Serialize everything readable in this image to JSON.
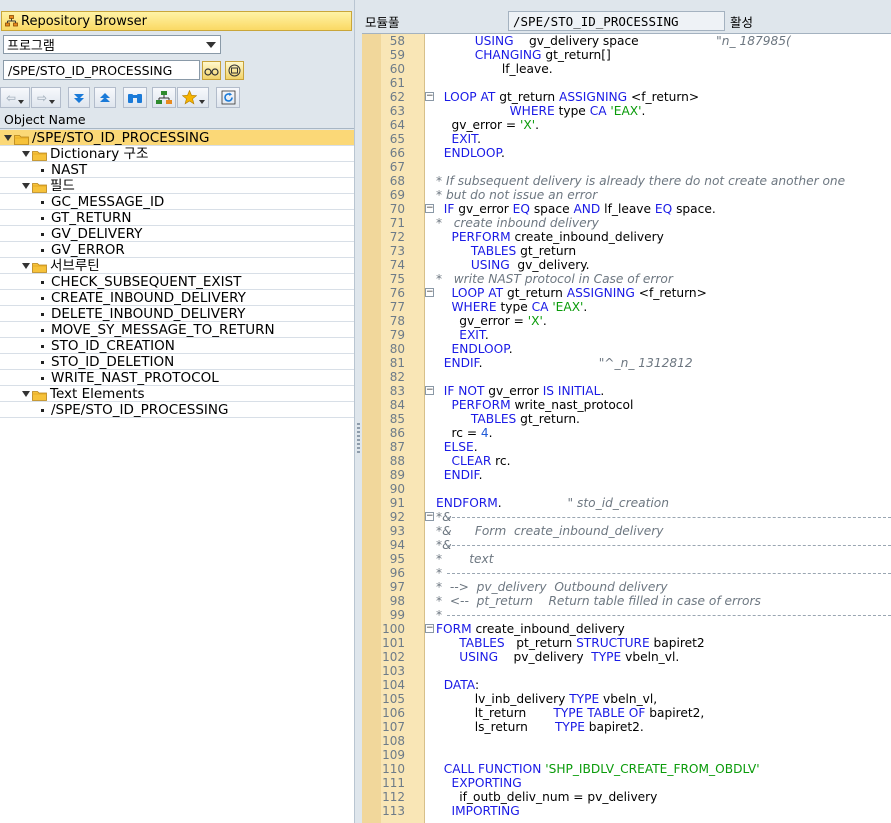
{
  "left": {
    "header_title": "Repository Browser",
    "object_type": "프로그램",
    "object_name_value": "/SPE/STO_ID_PROCESSING",
    "column_header": "Object Name",
    "tree": [
      {
        "label": "/SPE/STO_ID_PROCESSING",
        "level": 0,
        "kind": "folder",
        "selected": true
      },
      {
        "label": "Dictionary 구조",
        "level": 1,
        "kind": "folder"
      },
      {
        "label": "NAST",
        "level": 2,
        "kind": "leaf"
      },
      {
        "label": "필드",
        "level": 1,
        "kind": "folder"
      },
      {
        "label": "GC_MESSAGE_ID",
        "level": 2,
        "kind": "leaf"
      },
      {
        "label": "GT_RETURN",
        "level": 2,
        "kind": "leaf"
      },
      {
        "label": "GV_DELIVERY",
        "level": 2,
        "kind": "leaf"
      },
      {
        "label": "GV_ERROR",
        "level": 2,
        "kind": "leaf"
      },
      {
        "label": "서브루틴",
        "level": 1,
        "kind": "folder"
      },
      {
        "label": "CHECK_SUBSEQUENT_EXIST",
        "level": 2,
        "kind": "leaf"
      },
      {
        "label": "CREATE_INBOUND_DELIVERY",
        "level": 2,
        "kind": "leaf"
      },
      {
        "label": "DELETE_INBOUND_DELIVERY",
        "level": 2,
        "kind": "leaf"
      },
      {
        "label": "MOVE_SY_MESSAGE_TO_RETURN",
        "level": 2,
        "kind": "leaf"
      },
      {
        "label": "STO_ID_CREATION",
        "level": 2,
        "kind": "leaf"
      },
      {
        "label": "STO_ID_DELETION",
        "level": 2,
        "kind": "leaf"
      },
      {
        "label": "WRITE_NAST_PROTOCOL",
        "level": 2,
        "kind": "leaf"
      },
      {
        "label": "Text Elements",
        "level": 1,
        "kind": "folder"
      },
      {
        "label": "/SPE/STO_ID_PROCESSING",
        "level": 2,
        "kind": "leaf"
      }
    ]
  },
  "right": {
    "program_label": "모듈풀",
    "program_value": "/SPE/STO_ID_PROCESSING",
    "status": "활성"
  },
  "code_lines": [
    {
      "n": "58",
      "fold": "",
      "segs": [
        [
          "          ",
          ""
        ],
        [
          "USING",
          "kw"
        ],
        [
          "    gv_delivery space                    ",
          ""
        ],
        [
          "\"n_ 187985(",
          "cmt"
        ]
      ]
    },
    {
      "n": "59",
      "fold": "",
      "segs": [
        [
          "          ",
          ""
        ],
        [
          "CHANGING",
          "kw"
        ],
        [
          " gt_return[]",
          ""
        ]
      ]
    },
    {
      "n": "60",
      "fold": "",
      "segs": [
        [
          "                 lf_leave.",
          ""
        ]
      ]
    },
    {
      "n": "61",
      "fold": "",
      "segs": [
        [
          "",
          ""
        ]
      ]
    },
    {
      "n": "62",
      "fold": "-",
      "segs": [
        [
          "  ",
          ""
        ],
        [
          "LOOP AT",
          "kw"
        ],
        [
          " gt_return ",
          ""
        ],
        [
          "ASSIGNING",
          "kw"
        ],
        [
          " <f_return>",
          ""
        ]
      ]
    },
    {
      "n": "63",
      "fold": "",
      "segs": [
        [
          "                   ",
          ""
        ],
        [
          "WHERE",
          "kw"
        ],
        [
          " type ",
          ""
        ],
        [
          "CA",
          "kw"
        ],
        [
          " ",
          ""
        ],
        [
          "'EAX'",
          "str"
        ],
        [
          ".",
          ""
        ]
      ]
    },
    {
      "n": "64",
      "fold": "",
      "segs": [
        [
          "    gv_error = ",
          ""
        ],
        [
          "'X'",
          "str"
        ],
        [
          ".",
          ""
        ]
      ]
    },
    {
      "n": "65",
      "fold": "",
      "segs": [
        [
          "    ",
          ""
        ],
        [
          "EXIT",
          "kw"
        ],
        [
          ".",
          ""
        ]
      ]
    },
    {
      "n": "66",
      "fold": "",
      "segs": [
        [
          "  ",
          ""
        ],
        [
          "ENDLOOP",
          "kw"
        ],
        [
          ".",
          ""
        ]
      ]
    },
    {
      "n": "67",
      "fold": "",
      "segs": [
        [
          "",
          ""
        ]
      ]
    },
    {
      "n": "68",
      "fold": "",
      "segs": [
        [
          "* If subsequent delivery is already there do not create another one",
          "cmt"
        ]
      ]
    },
    {
      "n": "69",
      "fold": "",
      "segs": [
        [
          "* but do not issue an error",
          "cmt"
        ]
      ]
    },
    {
      "n": "70",
      "fold": "-",
      "segs": [
        [
          "  ",
          ""
        ],
        [
          "IF",
          "kw"
        ],
        [
          " gv_error ",
          ""
        ],
        [
          "EQ",
          "kw"
        ],
        [
          " space ",
          ""
        ],
        [
          "AND",
          "kw"
        ],
        [
          " lf_leave ",
          ""
        ],
        [
          "EQ",
          "kw"
        ],
        [
          " space.",
          ""
        ]
      ]
    },
    {
      "n": "71",
      "fold": "",
      "segs": [
        [
          "*   create inbound delivery",
          "cmt"
        ]
      ]
    },
    {
      "n": "72",
      "fold": "",
      "segs": [
        [
          "    ",
          ""
        ],
        [
          "PERFORM",
          "kw"
        ],
        [
          " create_inbound_delivery",
          ""
        ]
      ]
    },
    {
      "n": "73",
      "fold": "",
      "segs": [
        [
          "         ",
          ""
        ],
        [
          "TABLES",
          "kw"
        ],
        [
          " gt_return",
          ""
        ]
      ]
    },
    {
      "n": "74",
      "fold": "",
      "segs": [
        [
          "         ",
          ""
        ],
        [
          "USING",
          "kw"
        ],
        [
          "  gv_delivery.",
          ""
        ]
      ]
    },
    {
      "n": "75",
      "fold": "",
      "segs": [
        [
          "*   write NAST protocol in Case of error",
          "cmt"
        ]
      ]
    },
    {
      "n": "76",
      "fold": "-",
      "segs": [
        [
          "    ",
          ""
        ],
        [
          "LOOP AT",
          "kw"
        ],
        [
          " gt_return ",
          ""
        ],
        [
          "ASSIGNING",
          "kw"
        ],
        [
          " <f_return>",
          ""
        ]
      ]
    },
    {
      "n": "77",
      "fold": "",
      "segs": [
        [
          "    ",
          ""
        ],
        [
          "WHERE",
          "kw"
        ],
        [
          " type ",
          ""
        ],
        [
          "CA",
          "kw"
        ],
        [
          " ",
          ""
        ],
        [
          "'EAX'",
          "str"
        ],
        [
          ".",
          ""
        ]
      ]
    },
    {
      "n": "78",
      "fold": "",
      "segs": [
        [
          "      gv_error = ",
          ""
        ],
        [
          "'X'",
          "str"
        ],
        [
          ".",
          ""
        ]
      ]
    },
    {
      "n": "79",
      "fold": "",
      "segs": [
        [
          "      ",
          ""
        ],
        [
          "EXIT",
          "kw"
        ],
        [
          ".",
          ""
        ]
      ]
    },
    {
      "n": "80",
      "fold": "",
      "segs": [
        [
          "    ",
          ""
        ],
        [
          "ENDLOOP",
          "kw"
        ],
        [
          ".",
          ""
        ]
      ]
    },
    {
      "n": "81",
      "fold": "",
      "segs": [
        [
          "  ",
          ""
        ],
        [
          "ENDIF",
          "kw"
        ],
        [
          ".",
          ""
        ],
        [
          "                              \"^_n_ 1312812",
          "cmt"
        ]
      ]
    },
    {
      "n": "82",
      "fold": "",
      "segs": [
        [
          "",
          ""
        ]
      ]
    },
    {
      "n": "83",
      "fold": "-",
      "segs": [
        [
          "  ",
          ""
        ],
        [
          "IF NOT",
          "kw"
        ],
        [
          " gv_error ",
          ""
        ],
        [
          "IS INITIAL",
          "kw"
        ],
        [
          ".",
          ""
        ]
      ]
    },
    {
      "n": "84",
      "fold": "",
      "segs": [
        [
          "    ",
          ""
        ],
        [
          "PERFORM",
          "kw"
        ],
        [
          " write_nast_protocol",
          ""
        ]
      ]
    },
    {
      "n": "85",
      "fold": "",
      "segs": [
        [
          "         ",
          ""
        ],
        [
          "TABLES",
          "kw"
        ],
        [
          " gt_return.",
          ""
        ]
      ]
    },
    {
      "n": "86",
      "fold": "",
      "segs": [
        [
          "    rc = ",
          ""
        ],
        [
          "4",
          "num"
        ],
        [
          ".",
          ""
        ]
      ]
    },
    {
      "n": "87",
      "fold": "",
      "segs": [
        [
          "  ",
          ""
        ],
        [
          "ELSE",
          "kw"
        ],
        [
          ".",
          ""
        ]
      ]
    },
    {
      "n": "88",
      "fold": "",
      "segs": [
        [
          "    ",
          ""
        ],
        [
          "CLEAR",
          "kw"
        ],
        [
          " rc.",
          ""
        ]
      ]
    },
    {
      "n": "89",
      "fold": "",
      "segs": [
        [
          "  ",
          ""
        ],
        [
          "ENDIF",
          "kw"
        ],
        [
          ".",
          ""
        ]
      ]
    },
    {
      "n": "90",
      "fold": "",
      "segs": [
        [
          "",
          ""
        ]
      ]
    },
    {
      "n": "91",
      "fold": "",
      "segs": [
        [
          "",
          ""
        ],
        [
          "ENDFORM",
          "kw"
        ],
        [
          ".",
          ""
        ],
        [
          "                 \" sto_id_creation",
          "cmt"
        ]
      ]
    },
    {
      "n": "92",
      "fold": "-",
      "segs": [
        [
          "*&",
          "cmt"
        ]
      ],
      "dash": true
    },
    {
      "n": "93",
      "fold": "",
      "segs": [
        [
          "*&      Form  create_inbound_delivery",
          "cmt"
        ]
      ]
    },
    {
      "n": "94",
      "fold": "",
      "segs": [
        [
          "*&",
          "cmt"
        ]
      ],
      "dash": true
    },
    {
      "n": "95",
      "fold": "",
      "segs": [
        [
          "*       text",
          "cmt"
        ]
      ]
    },
    {
      "n": "96",
      "fold": "",
      "segs": [
        [
          "*",
          "cmt"
        ]
      ],
      "dash": true
    },
    {
      "n": "97",
      "fold": "",
      "segs": [
        [
          "*  -->  pv_delivery  Outbound delivery",
          "cmt"
        ]
      ]
    },
    {
      "n": "98",
      "fold": "",
      "segs": [
        [
          "*  <--  pt_return    Return table filled in case of errors",
          "cmt"
        ]
      ]
    },
    {
      "n": "99",
      "fold": "",
      "segs": [
        [
          "*",
          "cmt"
        ]
      ],
      "dash": true
    },
    {
      "n": "100",
      "fold": "-",
      "segs": [
        [
          "",
          ""
        ],
        [
          "FORM",
          "kw"
        ],
        [
          " create_inbound_delivery",
          ""
        ]
      ]
    },
    {
      "n": "101",
      "fold": "",
      "segs": [
        [
          "      ",
          ""
        ],
        [
          "TABLES",
          "kw"
        ],
        [
          "   pt_return ",
          ""
        ],
        [
          "STRUCTURE",
          "kw"
        ],
        [
          " bapiret2",
          ""
        ]
      ]
    },
    {
      "n": "102",
      "fold": "",
      "segs": [
        [
          "      ",
          ""
        ],
        [
          "USING",
          "kw"
        ],
        [
          "    pv_delivery  ",
          ""
        ],
        [
          "TYPE",
          "kw"
        ],
        [
          " vbeln_vl.",
          ""
        ]
      ]
    },
    {
      "n": "103",
      "fold": "",
      "segs": [
        [
          "",
          ""
        ]
      ]
    },
    {
      "n": "104",
      "fold": "",
      "segs": [
        [
          "  ",
          ""
        ],
        [
          "DATA",
          "kw"
        ],
        [
          ":",
          ""
        ]
      ]
    },
    {
      "n": "105",
      "fold": "",
      "segs": [
        [
          "          lv_inb_delivery ",
          ""
        ],
        [
          "TYPE",
          "kw"
        ],
        [
          " vbeln_vl,",
          ""
        ]
      ]
    },
    {
      "n": "106",
      "fold": "",
      "segs": [
        [
          "          lt_return       ",
          ""
        ],
        [
          "TYPE TABLE OF",
          "kw"
        ],
        [
          " bapiret2,",
          ""
        ]
      ]
    },
    {
      "n": "107",
      "fold": "",
      "segs": [
        [
          "          ls_return       ",
          ""
        ],
        [
          "TYPE",
          "kw"
        ],
        [
          " bapiret2.",
          ""
        ]
      ]
    },
    {
      "n": "108",
      "fold": "",
      "segs": [
        [
          "",
          ""
        ]
      ]
    },
    {
      "n": "109",
      "fold": "",
      "segs": [
        [
          "",
          ""
        ]
      ]
    },
    {
      "n": "110",
      "fold": "",
      "segs": [
        [
          "  ",
          ""
        ],
        [
          "CALL FUNCTION",
          "kw"
        ],
        [
          " ",
          ""
        ],
        [
          "'SHP_IBDLV_CREATE_FROM_OBDLV'",
          "str"
        ]
      ]
    },
    {
      "n": "111",
      "fold": "",
      "segs": [
        [
          "    ",
          ""
        ],
        [
          "EXPORTING",
          "kw"
        ]
      ]
    },
    {
      "n": "112",
      "fold": "",
      "segs": [
        [
          "      if_outb_deliv_num = pv_delivery",
          ""
        ]
      ]
    },
    {
      "n": "113",
      "fold": "",
      "segs": [
        [
          "    ",
          ""
        ],
        [
          "IMPORTING",
          "kw"
        ]
      ]
    }
  ]
}
